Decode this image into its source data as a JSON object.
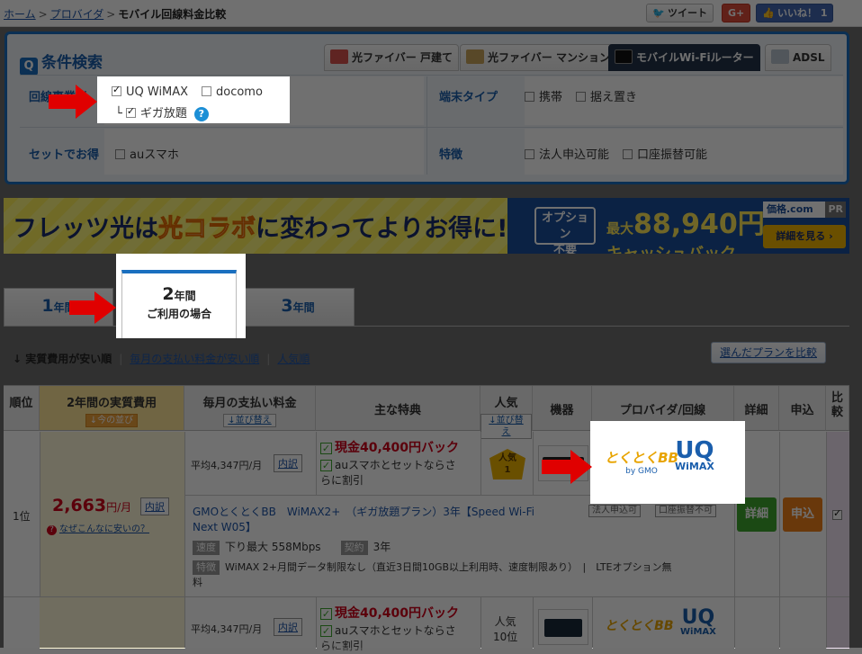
{
  "breadcrumb": {
    "home": "ホーム",
    "provider": "プロバイダ",
    "current": "モバイル回線料金比較"
  },
  "social": {
    "tweet": "ツイート",
    "gplus": "G+",
    "like": "いいね！ 1"
  },
  "search": {
    "title": "条件検索",
    "tabs": [
      "光ファイバー 戸建て",
      "光ファイバー マンション",
      "モバイルWi-Fiルーター",
      "ADSL"
    ],
    "line_label": "回線事業者",
    "uq_wimax": "UQ WiMAX",
    "docomo": "docomo",
    "giga": "ギガ放題",
    "help": "?",
    "terminal_label": "端末タイプ",
    "portable": "携帯",
    "stationary": "据え置き",
    "set_label": "セットでお得",
    "au_smartphone": "auスマホ",
    "feature_label": "特徴",
    "corporate": "法人申込可能",
    "bank_transfer": "口座振替可能"
  },
  "banner": {
    "text_pre": "フレッツ光は",
    "text_hk": "光コラボ",
    "text_post": "に変わってよりお得に!",
    "option_l1": "オプション",
    "option_l2": "不要",
    "max_label": "最大",
    "amount": "88,940円",
    "cashback": "キャッシュバック",
    "logo": "価格.com",
    "pr": "PR",
    "detail": "詳細を見る ›"
  },
  "year_tabs": {
    "y1_n": "1",
    "y1_s": "年間",
    "y2_n": "2",
    "y2_s": "年間",
    "y2_l2": "ご利用の場合",
    "y3_n": "3",
    "y3_s": "年間"
  },
  "sort": {
    "current": "↓ 実質費用が安い順",
    "monthly": "毎月の支払い料金が安い順",
    "popular": "人気順",
    "compare": "選んだプランを比較"
  },
  "table": {
    "headers": {
      "rank": "順位",
      "cost": "2年間の実質費用",
      "cost_sort": "↓今の並び",
      "monthly": "毎月の支払い料金",
      "monthly_sort": "↓並び替え",
      "benefit": "主な特典",
      "popular": "人気",
      "popular_sort": "↓並び替え",
      "device": "機器",
      "provider": "プロバイダ/回線",
      "detail": "詳細",
      "apply": "申込",
      "compare_l1": "比",
      "compare_l2": "較"
    },
    "row1": {
      "rank": "1位",
      "price": "2,663",
      "price_unit": "円/月",
      "breakdown": "内訳",
      "why_cheap": "なぜこんなに安いの？",
      "avg": "平均4,347円/月",
      "cashback": "現金40,400円バック",
      "au_set_l1": "auスマホとセットならさ",
      "au_set_l2": "らに割引",
      "pop_badge_l1": "人気",
      "pop_badge_l2": "1",
      "gmo": "とくとくBB",
      "gmo_sub": "by GMO",
      "uq": "UQ",
      "uq_sub": "WiMAX",
      "plan_l1": "GMOとくとくBB　WiMAX2+　（ギガ放題プラン）3年【Speed Wi-Fi",
      "plan_l2": "Next W05】",
      "corporate_pill": "法人申込可",
      "bank_pill": "口座振替不可",
      "speed_tag": "速度",
      "speed": "下り最大 558Mbps",
      "contract_tag": "契約",
      "contract": "3年",
      "feature_tag": "特徴",
      "feature_l1": "WiMAX 2+月間データ制限なし（直近3日間10GB以上利用時、速度制限あり）　|　LTEオプション無",
      "feature_l2": "料",
      "detail": "詳細",
      "apply": "申込"
    },
    "row2": {
      "avg": "平均4,347円/月",
      "breakdown": "内訳",
      "cashback": "現金40,400円バック",
      "au_set_l1": "auスマホとセットならさ",
      "au_set_l2": "らに割引",
      "pop_l1": "人気",
      "pop_l2": "10位",
      "gmo": "とくとくBB",
      "uq": "UQ",
      "uq_sub": "WiMAX"
    }
  }
}
